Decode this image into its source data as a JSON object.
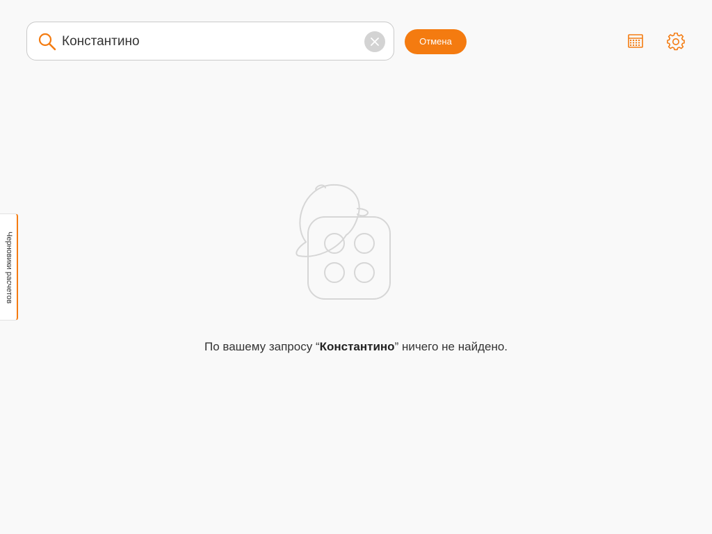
{
  "search": {
    "value": "Константино",
    "icon": "search-icon",
    "clear_icon": "close-icon"
  },
  "header": {
    "cancel_label": "Отмена",
    "calendar_icon": "calendar-icon",
    "settings_icon": "gear-icon"
  },
  "sidebar": {
    "drafts_tab_label": "Черновики расчетов"
  },
  "empty_state": {
    "illustration_icon": "empty-box-with-cap-icon",
    "message_prefix": "По вашему запросу “",
    "query": "Константино",
    "message_suffix": "” ничего не найдено."
  },
  "colors": {
    "accent": "#f47b10",
    "background": "#f9f9f9",
    "illustration_stroke": "#d6d6d6"
  }
}
